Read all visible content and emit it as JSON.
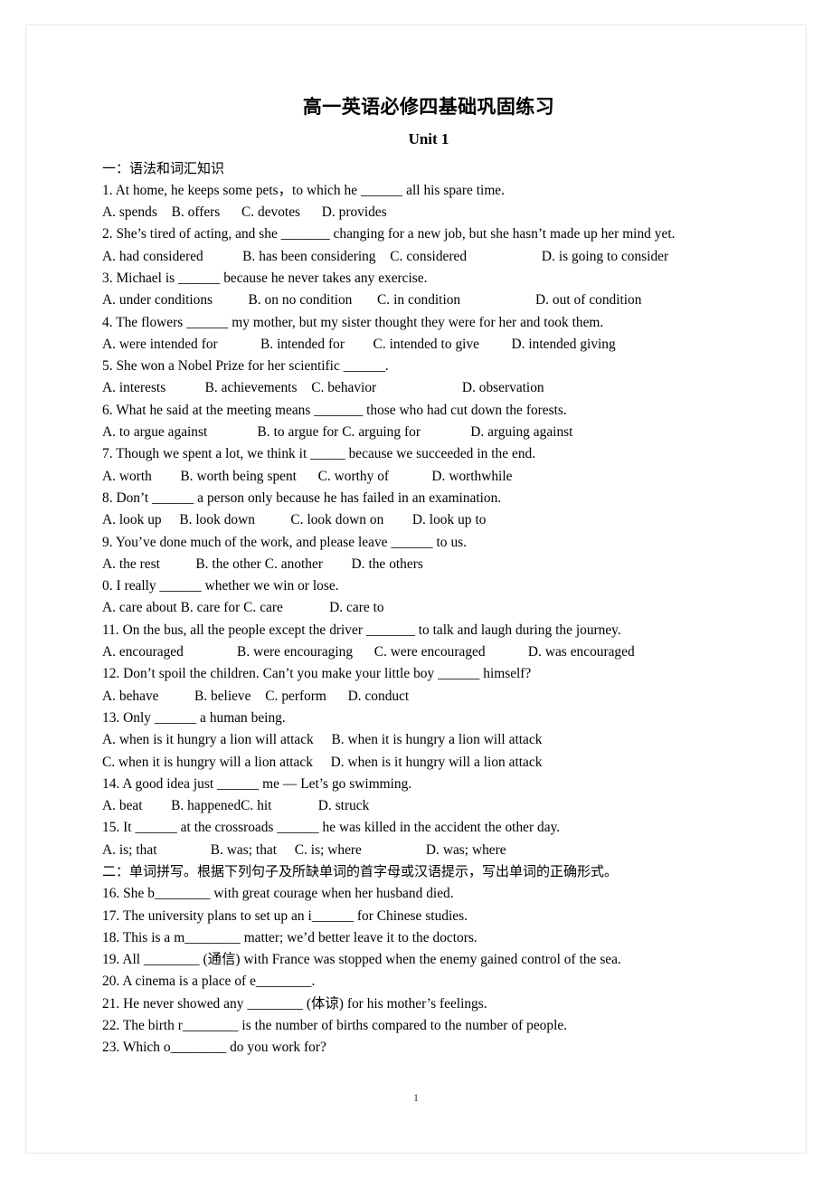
{
  "document": {
    "title": "高一英语必修四基础巩固练习",
    "subtitle": "Unit 1",
    "page_number": "1"
  },
  "section_one": {
    "heading": "一：语法和词汇知识",
    "items": [
      {
        "stem": "1. At home, he keeps some pets，to which he ______ all his spare time.",
        "options": "A. spends    B. offers      C. devotes      D. provides"
      },
      {
        "stem": "2. She’s tired of acting, and she _______ changing for a new job, but she hasn’t made up her mind yet.",
        "options": "A. had considered           B. has been considering    C. considered                     D. is going to consider"
      },
      {
        "stem": "3. Michael is ______ because he never takes any exercise.",
        "options": "A. under conditions          B. on no condition       C. in condition                     D. out of condition"
      },
      {
        "stem": "4. The flowers ______ my mother, but my sister thought they were for her and took them.",
        "options": "A. were intended for            B. intended for        C. intended to give         D. intended giving"
      },
      {
        "stem": "5. She won a Nobel Prize for her scientific ______.",
        "options": "A. interests           B. achievements    C. behavior                        D. observation"
      },
      {
        "stem": "6. What he said at the meeting means _______ those who had cut down the forests.",
        "options": "A. to argue against              B. to argue for C. arguing for              D. arguing against"
      },
      {
        "stem": "7. Though we spent a lot, we think it _____ because we succeeded in the end.",
        "options": "A. worth        B. worth being spent      C. worthy of            D. worthwhile"
      },
      {
        "stem": "8. Don’t ______ a person only because he has failed in an examination.",
        "options": "A. look up     B. look down          C. look down on        D. look up to"
      },
      {
        "stem": "9. You’ve done much of the work, and please leave ______ to us.",
        "options": "A. the rest          B. the other C. another        D. the others"
      },
      {
        "stem": "0. I really ______ whether we win or lose.",
        "options": "A. care about B. care for C. care             D. care to"
      },
      {
        "stem": "11. On the bus, all the people except the driver _______ to talk and laugh during the journey.",
        "options": "A. encouraged               B. were encouraging      C. were encouraged            D. was encouraged"
      },
      {
        "stem": "12. Don’t spoil the children. Can’t you make your little boy ______ himself?",
        "options": "A. behave          B. believe    C. perform      D. conduct"
      },
      {
        "stem": "13. Only ______ a human being.",
        "options": "A. when is it hungry a lion will attack     B. when it is hungry a lion will attack",
        "options2": "C. when it is hungry will a lion attack     D. when is it hungry will a lion attack"
      },
      {
        "stem": "14. A good idea just ______ me — Let’s go swimming.",
        "options": "A. beat        B. happenedC. hit             D. struck"
      },
      {
        "stem": "15. It ______ at the crossroads ______ he was killed in the accident the other day.",
        "options": "A. is; that               B. was; that     C. is; where                  D. was; where"
      }
    ]
  },
  "section_two": {
    "heading": "二：单词拼写。根据下列句子及所缺单词的首字母或汉语提示，写出单词的正确形式。",
    "items": [
      "16. She b________ with great courage when her husband died.",
      "17. The university plans to set up an i______ for Chinese studies.",
      "18. This is a m________ matter; we’d better leave it to the doctors.",
      "19. All ________ (通信) with France was stopped when the enemy gained control of the sea.",
      "20. A cinema is a place of e________.",
      "21. He never showed any ________ (体谅) for his mother’s feelings.",
      "22. The birth r________ is the number of births compared to the number of people.",
      "23. Which o________ do you work for?"
    ]
  }
}
